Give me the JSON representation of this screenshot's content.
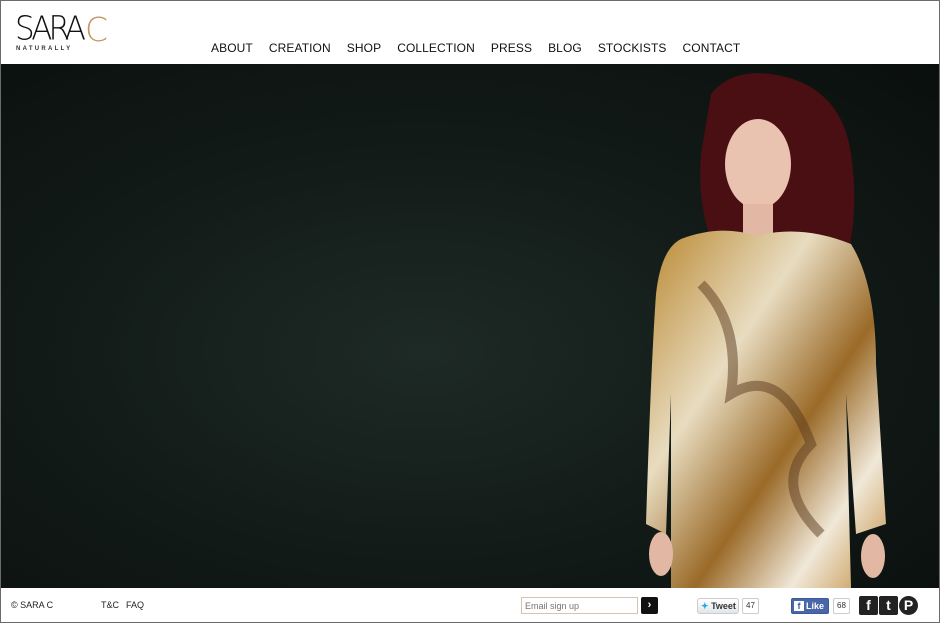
{
  "brand": {
    "name_main": "SARA",
    "name_accent": "C",
    "tagline": "NATURALLY",
    "accent_color": "#c49462"
  },
  "nav": {
    "items": [
      {
        "label": "ABOUT"
      },
      {
        "label": "CREATION"
      },
      {
        "label": "SHOP"
      },
      {
        "label": "COLLECTION"
      },
      {
        "label": "PRESS"
      },
      {
        "label": "BLOG"
      },
      {
        "label": "STOCKISTS"
      },
      {
        "label": "CONTACT"
      }
    ]
  },
  "footer": {
    "copyright": "© SARA C",
    "tc": "T&C",
    "faq": "FAQ",
    "email_placeholder": "Email sign up",
    "submit_icon": "chevron-right-icon",
    "tweet_label": "Tweet",
    "tweet_count": "47",
    "like_label": "Like",
    "like_count": "68",
    "social": [
      {
        "icon": "facebook-icon",
        "glyph": "f"
      },
      {
        "icon": "twitter-icon",
        "glyph": "t"
      },
      {
        "icon": "pinterest-icon",
        "glyph": "P"
      }
    ]
  }
}
